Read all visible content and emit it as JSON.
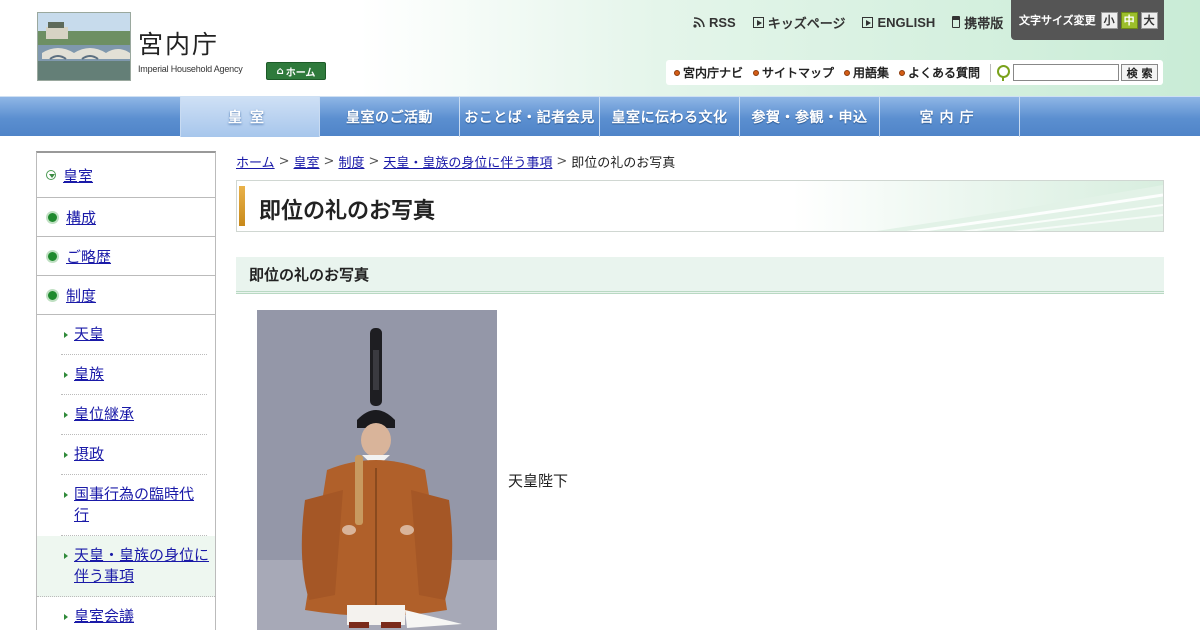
{
  "header": {
    "logo_jp": "宮内庁",
    "logo_en": "Imperial Household Agency",
    "home_label": "ホーム",
    "top_links": [
      {
        "label": "RSS",
        "icon": "rss-icon"
      },
      {
        "label": "キッズページ",
        "icon": "play-icon"
      },
      {
        "label": "ENGLISH",
        "icon": "play-icon"
      },
      {
        "label": "携帯版",
        "icon": "mobile-icon"
      }
    ],
    "font_size": {
      "label": "文字サイズ変更",
      "small": "小",
      "medium": "中",
      "large": "大",
      "active": "中"
    },
    "sub_links": [
      "宮内庁ナビ",
      "サイトマップ",
      "用語集",
      "よくある質問"
    ],
    "search": {
      "placeholder": "",
      "button": "検 索"
    }
  },
  "global_nav": [
    "皇室",
    "皇室のご活動",
    "おことば・記者会見",
    "皇室に伝わる文化",
    "参賀・参観・申込",
    "宮内庁"
  ],
  "sidebar": {
    "top": "皇室",
    "sections": [
      "構成",
      "ご略歴",
      "制度"
    ],
    "sub_items": [
      "天皇",
      "皇族",
      "皇位継承",
      "摂政",
      "国事行為の臨時代行",
      "天皇・皇族の身位に伴う事項",
      "皇室会議"
    ],
    "active_sub": "天皇・皇族の身位に伴う事項"
  },
  "breadcrumb": {
    "items": [
      "ホーム",
      "皇室",
      "制度",
      "天皇・皇族の身位に伴う事項"
    ],
    "current": "即位の礼のお写真"
  },
  "main": {
    "page_title": "即位の礼のお写真",
    "section_title": "即位の礼のお写真",
    "photo_caption": "天皇陛下"
  },
  "colors": {
    "nav_blue": "#5b8fd0",
    "accent_green": "#2f7a3c",
    "title_gold": "#d69a2c",
    "link": "#1a1aa8"
  }
}
